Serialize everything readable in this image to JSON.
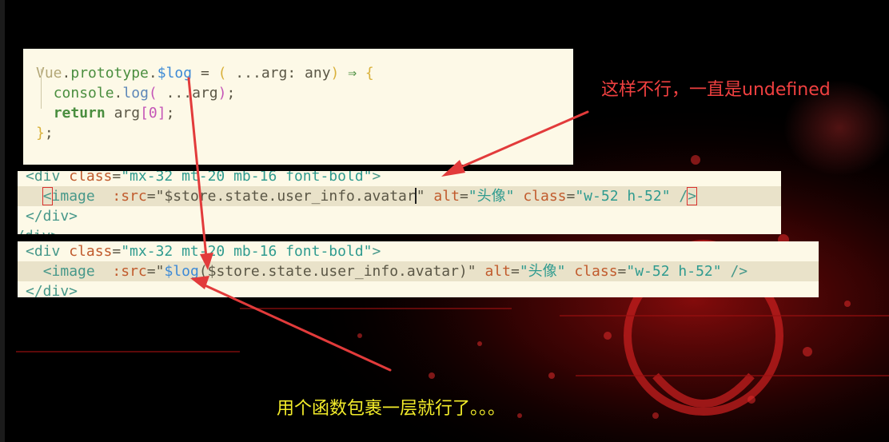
{
  "snippet_prototype": {
    "line1": {
      "obj": "Vue",
      "dot1": ".",
      "proto": "prototype",
      "dot2": ".",
      "name": "$log",
      "eq": " = ",
      "lparen": "(",
      "spread": " ...",
      "arg": "arg",
      "colon": ": ",
      "type": "any",
      "rparen": ")",
      "arrow": " ⇒ ",
      "lbrace": "{"
    },
    "line2": {
      "indent": "  ",
      "console": "console",
      "dot": ".",
      "method": "log",
      "lparen": "(",
      "spread": " ...",
      "arg": "arg",
      "rparen": ")",
      "semi": ";"
    },
    "line3": {
      "indent": "  ",
      "keyword": "return",
      "space": " ",
      "arg": "arg",
      "lbracket": "[",
      "index": "0",
      "rbracket": "]",
      "semi": ";"
    },
    "line4": {
      "rbrace": "}",
      "semi": ";"
    }
  },
  "snippet_broken": {
    "line1": {
      "open": "<div ",
      "attr": "class",
      "eq": "=",
      "value": "\"mx-32 mt-20 mb-16 font-bold\"",
      "close": ">"
    },
    "line2": {
      "indent": "  ",
      "lt": "<",
      "tag": "image",
      "space1": "  ",
      "src_attr": ":src",
      "eq1": "=",
      "src_open": "\"",
      "src_expr": "$store.state.user_info.avatar",
      "src_close": "\"",
      "space2": " ",
      "alt_attr": "alt",
      "eq2": "=",
      "alt_value": "\"头像\"",
      "space3": " ",
      "class_attr": "class",
      "eq3": "=",
      "class_value": "\"w-52 h-52\"",
      "space4": " ",
      "slash": "/",
      "gt": ">"
    },
    "line3": {
      "text": "</div>"
    },
    "line4": {
      "text": "/div>"
    }
  },
  "snippet_fixed": {
    "line1": {
      "open": "<div ",
      "attr": "class",
      "eq": "=",
      "value": "\"mx-32 mt-20 mb-16 font-bold\"",
      "close": ">"
    },
    "line2": {
      "indent": "  ",
      "open": "<image",
      "space1": "  ",
      "src_attr": ":src",
      "eq1": "=",
      "src_open": "\"",
      "fn": "$log",
      "expr": "($store.state.user_info.avatar)",
      "src_close": "\"",
      "space2": " ",
      "alt_attr": "alt",
      "eq2": "=",
      "alt_value": "\"头像\"",
      "space3": " ",
      "class_attr": "class",
      "eq3": "=",
      "class_value": "\"w-52 h-52\"",
      "space4": " ",
      "end": "/>"
    },
    "line3": {
      "text": "</div>"
    }
  },
  "annotations": {
    "problem": "这样不行，一直是undefined",
    "solution": "用个函数包裹一层就行了。。。"
  },
  "colors": {
    "annotation_red": "#f04040",
    "annotation_yellow": "#f3ec2a",
    "arrow_red": "#e23b3b",
    "panel_bg": "#fdf9e7"
  }
}
